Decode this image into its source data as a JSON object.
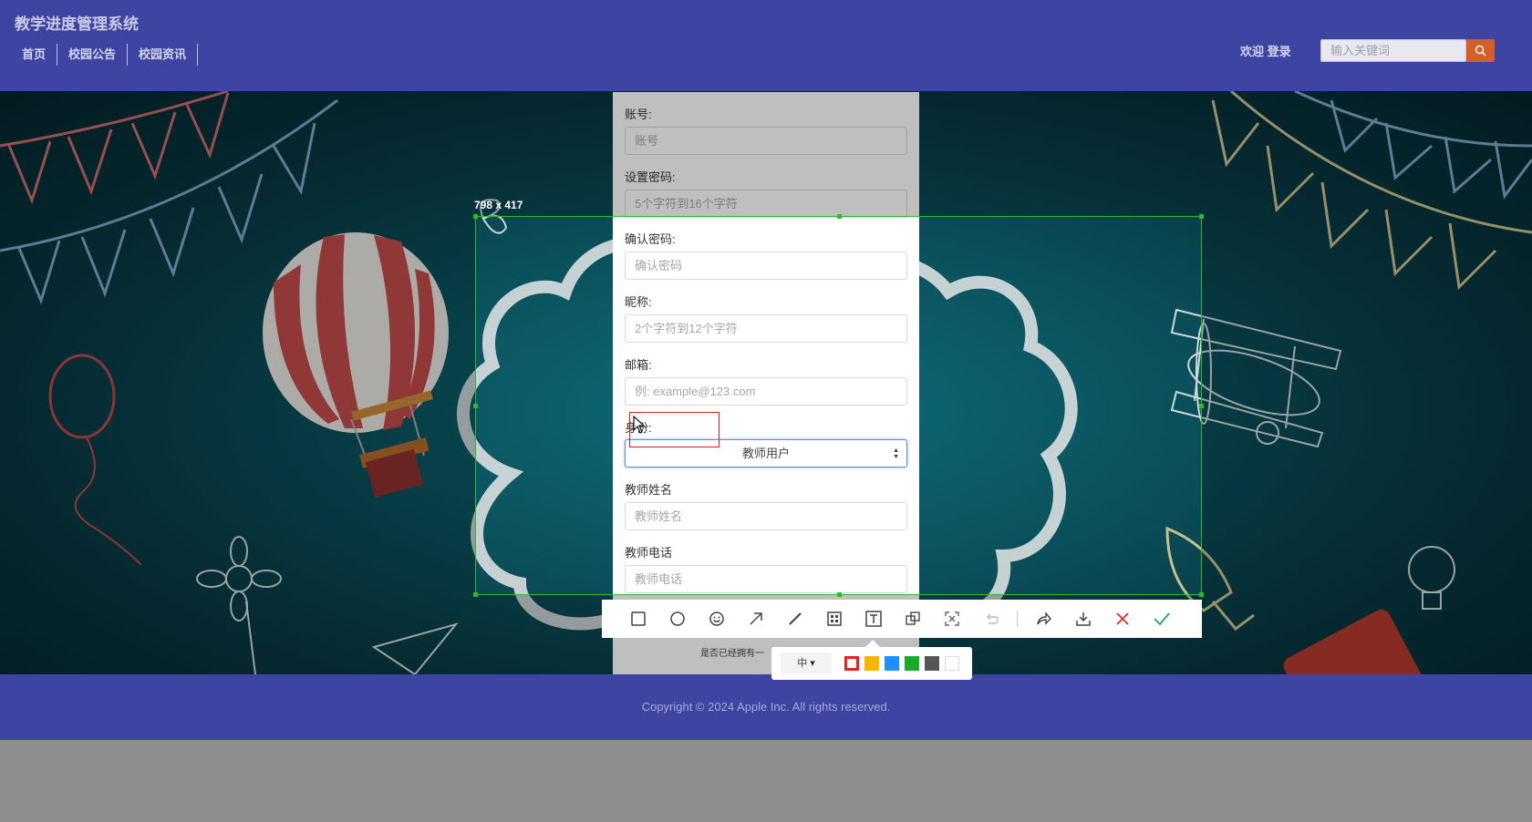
{
  "header": {
    "site_title": "教学进度管理系统",
    "nav": [
      "首页",
      "校园公告",
      "校园资讯"
    ],
    "welcome": "欢迎 登录",
    "search_placeholder": "输入关键词"
  },
  "form": {
    "account_label": "账号:",
    "account_placeholder": "账号",
    "password_label": "设置密码:",
    "password_placeholder": "5个字符到16个字符",
    "confirm_label": "确认密码:",
    "confirm_placeholder": "确认密码",
    "nickname_label": "昵称:",
    "nickname_placeholder": "2个字符到12个字符",
    "email_label": "邮箱:",
    "email_placeholder": "例: example@123.com",
    "identity_label": "身份:",
    "identity_value": "教师用户",
    "teacher_name_label": "教师姓名",
    "teacher_name_placeholder": "教师姓名",
    "teacher_phone_label": "教师电话",
    "teacher_phone_placeholder": "教师电话",
    "already_text": "是否已经拥有一"
  },
  "screenshot_tool": {
    "size_label": "798 x 417",
    "tools": [
      "rectangle-icon",
      "ellipse-icon",
      "emoji-icon",
      "arrow-icon",
      "brush-icon",
      "mosaic-icon",
      "text-icon",
      "copy-icon",
      "pin-icon",
      "undo-icon",
      "share-icon",
      "download-icon",
      "cancel-icon",
      "confirm-icon"
    ],
    "font_size": "中",
    "colors": [
      "#e0241b",
      "#f5b800",
      "#1e90ff",
      "#1aaa2a",
      "#555555",
      "#ffffff"
    ]
  },
  "footer": {
    "copyright": "Copyright © 2024 Apple Inc. All rights reserved."
  }
}
